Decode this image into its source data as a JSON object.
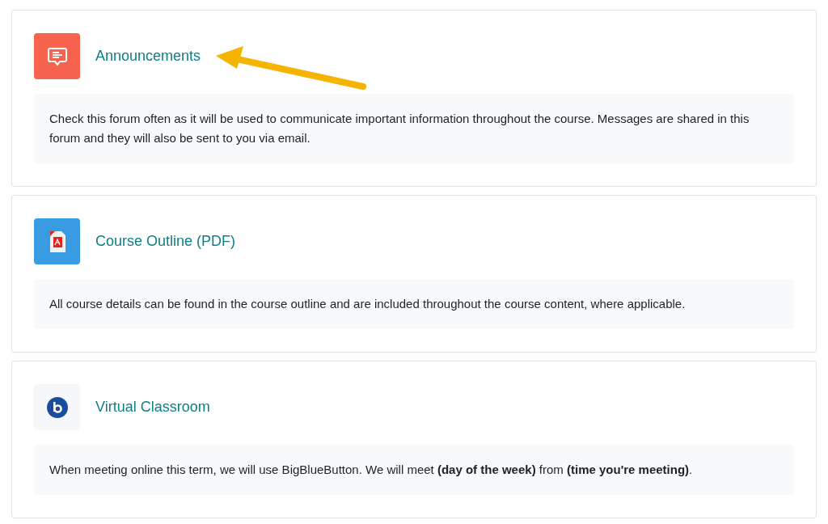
{
  "activities": [
    {
      "kind": "forum",
      "title": "Announcements",
      "description": "Check this forum often as it will be used to communicate important information throughout the course. Messages are shared in this forum and they will also be sent to you via email.",
      "highlighted": true
    },
    {
      "kind": "pdf",
      "title": "Course Outline (PDF)",
      "description": "All course details can be found in the course outline and are included throughout the course content, where applicable.",
      "highlighted": false
    },
    {
      "kind": "bbb",
      "title": "Virtual Classroom",
      "description": "When meeting online this term, we will use BigBlueButton. We will meet **(day of the week)** from **(time you're meeting)**.",
      "highlighted": false
    }
  ]
}
